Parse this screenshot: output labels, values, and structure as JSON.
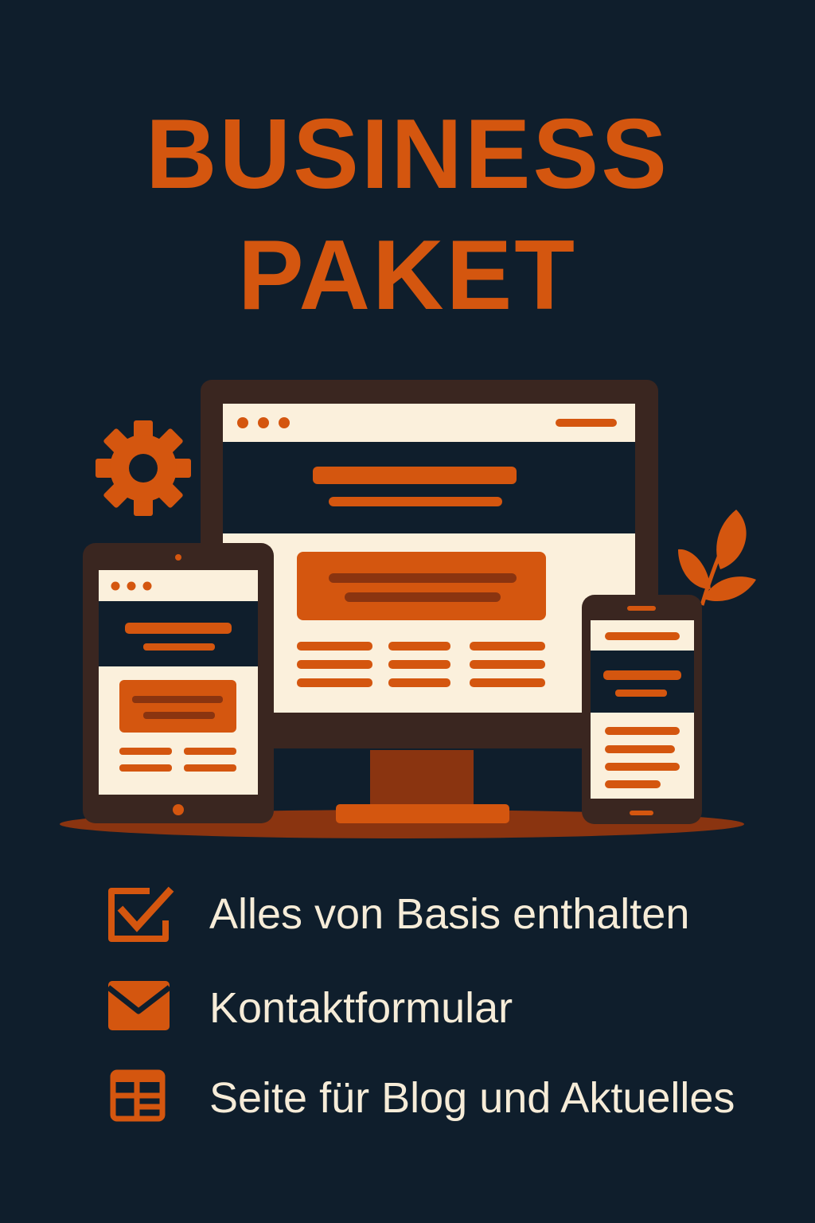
{
  "title": {
    "line1": "BUSINESS",
    "line2": "PAKET"
  },
  "colors": {
    "background": "#0f1e2c",
    "accent": "#d4560f",
    "cream": "#fbf0dc",
    "device_frame": "#3a2620",
    "text": "#f6ecd8"
  },
  "illustration": {
    "icons": [
      "gear-icon",
      "leaf-icon"
    ],
    "devices": [
      "monitor",
      "tablet",
      "smartphone"
    ]
  },
  "features": [
    {
      "icon": "checkbox-icon",
      "label": "Alles von Basis enthalten"
    },
    {
      "icon": "envelope-icon",
      "label": "Kontaktformular"
    },
    {
      "icon": "layout-icon",
      "label": "Seite für Blog und Aktuelles"
    }
  ]
}
